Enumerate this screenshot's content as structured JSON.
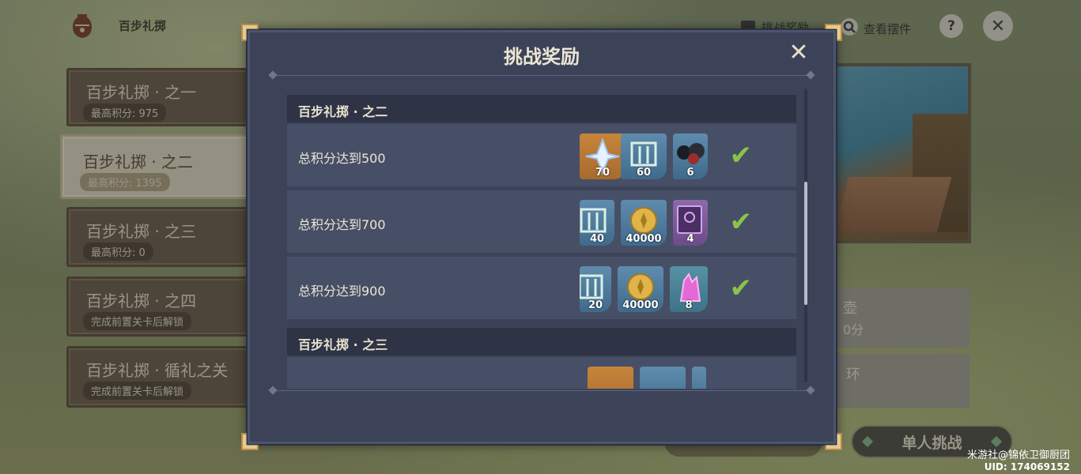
{
  "event": {
    "title": "百步礼掷",
    "icon": "urn-icon"
  },
  "topbar": {
    "reward_label": "挑战奖励",
    "view_label": "查看摆件",
    "help_label": "?",
    "close_label": "✕"
  },
  "stages": [
    {
      "title": "百步礼掷 · 之一",
      "sub": "最高积分: 975"
    },
    {
      "title": "百步礼掷 · 之二",
      "sub": "最高积分: 1395"
    },
    {
      "title": "百步礼掷 · 之三",
      "sub": "最高积分: 0"
    },
    {
      "title": "百步礼掷 · 之四",
      "sub": "完成前置关卡后解锁"
    },
    {
      "title": "百步礼掷 · 循礼之关",
      "sub": "完成前置关卡后解锁"
    }
  ],
  "right_cards": {
    "card1_title": "壶",
    "card1_sub": "0分",
    "card2_title": "环"
  },
  "single_button": "单人挑战",
  "watermark": {
    "line1": "米游社@锦依卫御厨团",
    "line2": "UID: 174069152"
  },
  "modal": {
    "title": "挑战奖励",
    "close": "✕",
    "sections": [
      {
        "header": "百步礼掷 · 之二",
        "rows": [
          {
            "condition": "总积分达到500",
            "items": [
              {
                "icon": "primogem-icon",
                "qty": "70"
              },
              {
                "icon": "gate-icon",
                "qty": "60"
              },
              {
                "icon": "ore-icon",
                "qty": "6"
              }
            ],
            "claimed": "✔"
          },
          {
            "condition": "总积分达到700",
            "items": [
              {
                "icon": "gate-icon",
                "qty": "40"
              },
              {
                "icon": "mora-icon",
                "qty": "40000"
              },
              {
                "icon": "book-icon",
                "qty": "4"
              }
            ],
            "claimed": "✔"
          },
          {
            "condition": "总积分达到900",
            "items": [
              {
                "icon": "gate-icon",
                "qty": "20"
              },
              {
                "icon": "mora-icon",
                "qty": "40000"
              },
              {
                "icon": "crystal-icon",
                "qty": "8"
              }
            ],
            "claimed": "✔"
          }
        ]
      },
      {
        "header": "百步礼掷 · 之三",
        "rows": []
      }
    ]
  }
}
